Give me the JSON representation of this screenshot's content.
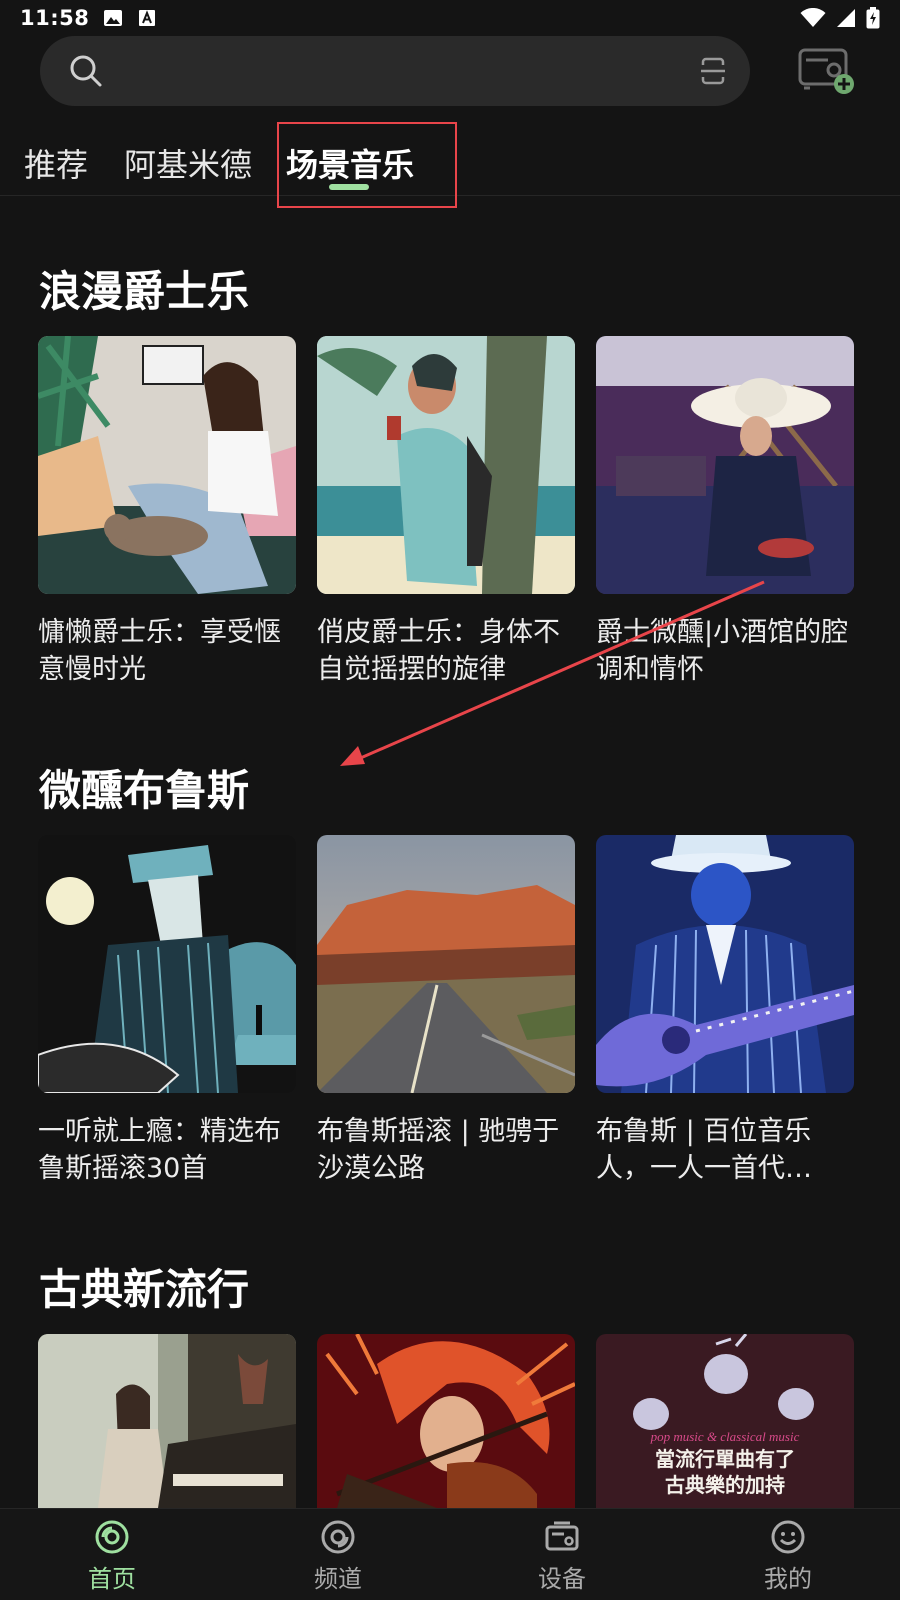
{
  "status_bar": {
    "time": "11:58",
    "icons": [
      "image-icon",
      "text-a-icon",
      "wifi-icon",
      "signal-icon",
      "battery-charging-icon"
    ]
  },
  "search": {
    "placeholder": "",
    "icons": [
      "search-icon",
      "scan-icon"
    ],
    "device_button_icon": "device-add-icon"
  },
  "tabs": [
    {
      "label": "推荐",
      "active": false
    },
    {
      "label": "阿基米德",
      "active": false
    },
    {
      "label": "场景音乐",
      "active": true
    }
  ],
  "sections": [
    {
      "title": "浪漫爵士乐",
      "cards": [
        {
          "title": "慵懒爵士乐：享受惬意慢时光"
        },
        {
          "title": "俏皮爵士乐：身体不自觉摇摆的旋律"
        },
        {
          "title": "爵士微醺|小酒馆的腔调和情怀"
        }
      ]
    },
    {
      "title": "微醺布鲁斯",
      "cards": [
        {
          "title": "一听就上瘾：精选布鲁斯摇滚30首"
        },
        {
          "title": "布鲁斯摇滚 | 驰骋于沙漠公路"
        },
        {
          "title": "布鲁斯 | 百位音乐人，一人一首代…"
        }
      ]
    },
    {
      "title": "古典新流行",
      "cards": [
        {
          "title": ""
        },
        {
          "title": ""
        },
        {
          "title": "",
          "cover_text": [
            "pop music & classical music",
            "當流行單曲有了",
            "古典樂的加持"
          ]
        }
      ]
    }
  ],
  "bottom_nav": [
    {
      "label": "首页",
      "icon": "disc-home-icon",
      "active": true
    },
    {
      "label": "频道",
      "icon": "disc-channel-icon",
      "active": false
    },
    {
      "label": "设备",
      "icon": "radio-device-icon",
      "active": false
    },
    {
      "label": "我的",
      "icon": "smiley-profile-icon",
      "active": false
    }
  ],
  "colors": {
    "background": "#141414",
    "accent": "#9fe0a0",
    "annotation": "#e8454a"
  }
}
